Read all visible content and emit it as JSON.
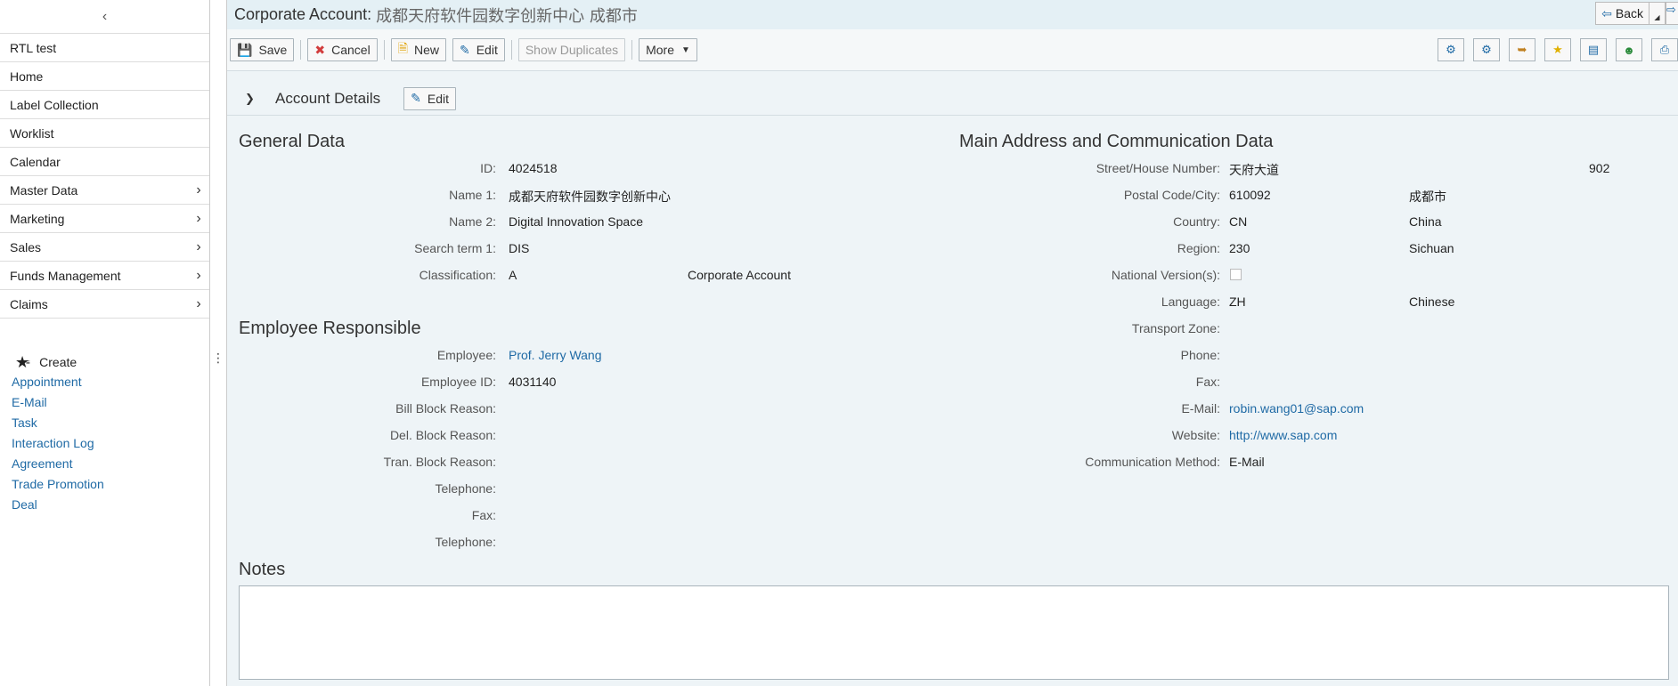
{
  "sidebar": {
    "collapse_icon": "chevron-left-icon",
    "items": [
      {
        "label": "RTL test",
        "has_sub": false
      },
      {
        "label": "Home",
        "has_sub": false
      },
      {
        "label": "Label Collection",
        "has_sub": false
      },
      {
        "label": "Worklist",
        "has_sub": false
      },
      {
        "label": "Calendar",
        "has_sub": false
      },
      {
        "label": "Master Data",
        "has_sub": true
      },
      {
        "label": "Marketing",
        "has_sub": true
      },
      {
        "label": "Sales",
        "has_sub": true
      },
      {
        "label": "Funds Management",
        "has_sub": true
      },
      {
        "label": "Claims",
        "has_sub": true
      }
    ],
    "create": {
      "label": "Create",
      "links": [
        "Appointment",
        "E-Mail",
        "Task",
        "Interaction Log",
        "Agreement",
        "Trade Promotion",
        "Deal"
      ]
    }
  },
  "header": {
    "title_prefix": "Corporate Account:",
    "title_name": "成都天府软件园数字创新中心 成都市",
    "back_label": "Back"
  },
  "toolbar": {
    "save": "Save",
    "cancel": "Cancel",
    "new": "New",
    "edit": "Edit",
    "show_duplicates": "Show Duplicates",
    "more": "More"
  },
  "section": {
    "title": "Account Details",
    "edit": "Edit"
  },
  "general_data": {
    "title": "General Data",
    "id_label": "ID:",
    "id": "4024518",
    "name1_label": "Name 1:",
    "name1": "成都天府软件园数字创新中心",
    "name2_label": "Name 2:",
    "name2": "Digital Innovation Space",
    "search_label": "Search term 1:",
    "search": "DIS",
    "class_label": "Classification:",
    "class_code": "A",
    "class_text": "Corporate Account"
  },
  "employee": {
    "title": "Employee Responsible",
    "employee_label": "Employee:",
    "employee": "Prof. Jerry Wang",
    "empid_label": "Employee ID:",
    "empid": "4031140",
    "bill_label": "Bill Block Reason:",
    "del_label": "Del. Block Reason:",
    "tran_label": "Tran. Block Reason:",
    "tel1_label": "Telephone:",
    "fax_label": "Fax:",
    "tel2_label": "Telephone:"
  },
  "address": {
    "title": "Main Address and Communication Data",
    "street_label": "Street/House Number:",
    "street": "天府大道",
    "house": "902",
    "postal_label": "Postal Code/City:",
    "postal": "610092",
    "city": "成都市",
    "country_label": "Country:",
    "country_code": "CN",
    "country": "China",
    "region_label": "Region:",
    "region_code": "230",
    "region": "Sichuan",
    "national_label": "National Version(s):",
    "language_label": "Language:",
    "language_code": "ZH",
    "language": "Chinese",
    "transport_label": "Transport Zone:",
    "phone_label": "Phone:",
    "fax_label": "Fax:",
    "email_label": "E-Mail:",
    "email": "robin.wang01@sap.com",
    "website_label": "Website:",
    "website": "http://www.sap.com",
    "comm_label": "Communication Method:",
    "comm": "E-Mail"
  },
  "notes": {
    "title": "Notes",
    "value": ""
  }
}
